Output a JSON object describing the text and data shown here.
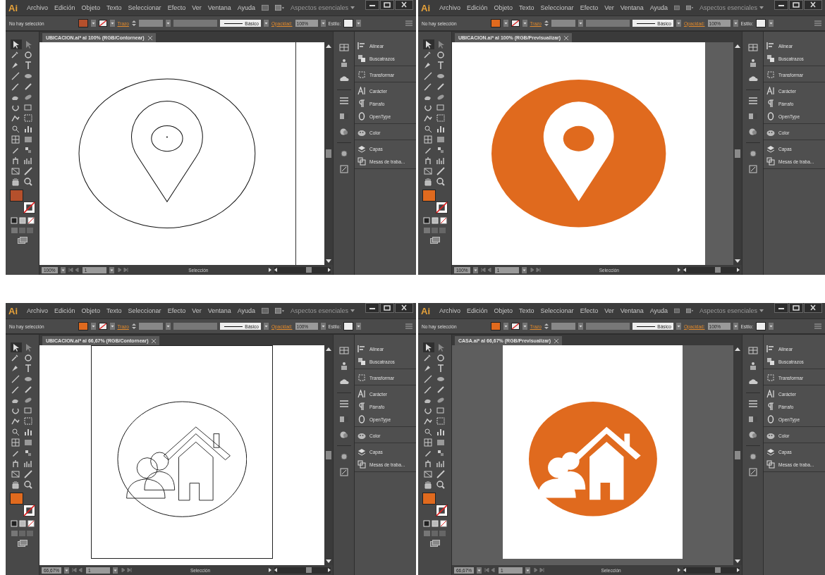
{
  "windows": [
    {
      "app_logo": "Ai",
      "menu": [
        "Archivo",
        "Edición",
        "Objeto",
        "Texto",
        "Seleccionar",
        "Efecto",
        "Ver",
        "Ventana",
        "Ayuda"
      ],
      "workspace": "Aspectos esenciales",
      "selection": "No hay selección",
      "stroke_label": "Trazo",
      "stroke_profile": "Básico",
      "opacity_label": "Opacidad:",
      "opacity": "100%",
      "style_label": "Estilo:",
      "color": "#b5502c",
      "document_tab": "UBICACION.ai* al 100% (RGB/Contornear)",
      "outline": true,
      "kind": "pin",
      "zoom": "100%",
      "page": "1",
      "status": "Selección",
      "panel_groups": [
        [
          {
            "kind": "align",
            "label": "Alinear"
          },
          {
            "kind": "pathfinder",
            "label": "Buscatrazos"
          }
        ],
        [
          {
            "kind": "transform",
            "label": "Transformar"
          }
        ],
        [
          {
            "kind": "character",
            "label": "Carácter"
          },
          {
            "kind": "paragraph",
            "label": "Párrafo"
          },
          {
            "kind": "opentype",
            "label": "OpenType"
          }
        ],
        [
          {
            "kind": "color",
            "label": "Color"
          }
        ],
        [
          {
            "kind": "layers",
            "label": "Capas"
          },
          {
            "kind": "artboards",
            "label": "Mesas de traba..."
          }
        ]
      ]
    },
    {
      "app_logo": "Ai",
      "menu": [
        "Archivo",
        "Edición",
        "Objeto",
        "Texto",
        "Seleccionar",
        "Efecto",
        "Ver",
        "Ventana",
        "Ayuda"
      ],
      "workspace": "Aspectos esenciales",
      "selection": "No hay selección",
      "stroke_label": "Trazo",
      "stroke_profile": "Básico",
      "opacity_label": "Opacidad:",
      "opacity": "100%",
      "style_label": "Estilo:",
      "color": "#e06a1e",
      "document_tab": "UBICACION.ai* al 100% (RGB/Previsualizar)",
      "outline": false,
      "kind": "pin",
      "zoom": "100%",
      "page": "1",
      "status": "Selección",
      "panel_groups": [
        [
          {
            "kind": "align",
            "label": "Alinear"
          },
          {
            "kind": "pathfinder",
            "label": "Buscatrazos"
          }
        ],
        [
          {
            "kind": "transform",
            "label": "Transformar"
          }
        ],
        [
          {
            "kind": "character",
            "label": "Carácter"
          },
          {
            "kind": "paragraph",
            "label": "Párrafo"
          },
          {
            "kind": "opentype",
            "label": "OpenType"
          }
        ],
        [
          {
            "kind": "color",
            "label": "Color"
          }
        ],
        [
          {
            "kind": "layers",
            "label": "Capas"
          },
          {
            "kind": "artboards",
            "label": "Mesas de traba..."
          }
        ]
      ]
    },
    {
      "app_logo": "Ai",
      "menu": [
        "Archivo",
        "Edición",
        "Objeto",
        "Texto",
        "Seleccionar",
        "Efecto",
        "Ver",
        "Ventana",
        "Ayuda"
      ],
      "workspace": "Aspectos esenciales",
      "selection": "No hay selección",
      "stroke_label": "Trazo",
      "stroke_profile": "Básico",
      "opacity_label": "Opacidad:",
      "opacity": "100%",
      "style_label": "Estilo:",
      "color": "#e06a1e",
      "document_tab": "UBICACION.ai* al 66,67% (RGB/Contornear)",
      "outline": true,
      "kind": "house",
      "zoom": "66,67%",
      "page": "1",
      "status": "Selección",
      "panel_groups": [
        [
          {
            "kind": "align",
            "label": "Alinear"
          },
          {
            "kind": "pathfinder",
            "label": "Buscatrazos"
          }
        ],
        [
          {
            "kind": "transform",
            "label": "Transformar"
          }
        ],
        [
          {
            "kind": "character",
            "label": "Carácter"
          },
          {
            "kind": "paragraph",
            "label": "Párrafo"
          },
          {
            "kind": "opentype",
            "label": "OpenType"
          }
        ],
        [
          {
            "kind": "color",
            "label": "Color"
          }
        ],
        [
          {
            "kind": "layers",
            "label": "Capas"
          },
          {
            "kind": "artboards",
            "label": "Mesas de traba..."
          }
        ]
      ]
    },
    {
      "app_logo": "Ai",
      "menu": [
        "Archivo",
        "Edición",
        "Objeto",
        "Texto",
        "Seleccionar",
        "Efecto",
        "Ver",
        "Ventana",
        "Ayuda"
      ],
      "workspace": "Aspectos esenciales",
      "selection": "No hay selección",
      "stroke_label": "Trazo",
      "stroke_profile": "Básico",
      "opacity_label": "Opacidad:",
      "opacity": "100%",
      "style_label": "Estilo:",
      "color": "#e06a1e",
      "document_tab": "CASA.ai* al 66,67% (RGB/Previsualizar)",
      "outline": false,
      "kind": "house",
      "zoom": "66,67%",
      "page": "1",
      "status": "Selección",
      "panel_groups": [
        [
          {
            "kind": "align",
            "label": "Alinear"
          },
          {
            "kind": "pathfinder",
            "label": "Buscatrazos"
          }
        ],
        [
          {
            "kind": "transform",
            "label": "Transformar"
          }
        ],
        [
          {
            "kind": "character",
            "label": "Carácter"
          },
          {
            "kind": "paragraph",
            "label": "Párrafo"
          },
          {
            "kind": "opentype",
            "label": "OpenType"
          }
        ],
        [
          {
            "kind": "color",
            "label": "Color"
          }
        ],
        [
          {
            "kind": "layers",
            "label": "Capas"
          },
          {
            "kind": "artboards",
            "label": "Mesas de traba..."
          }
        ]
      ]
    }
  ]
}
